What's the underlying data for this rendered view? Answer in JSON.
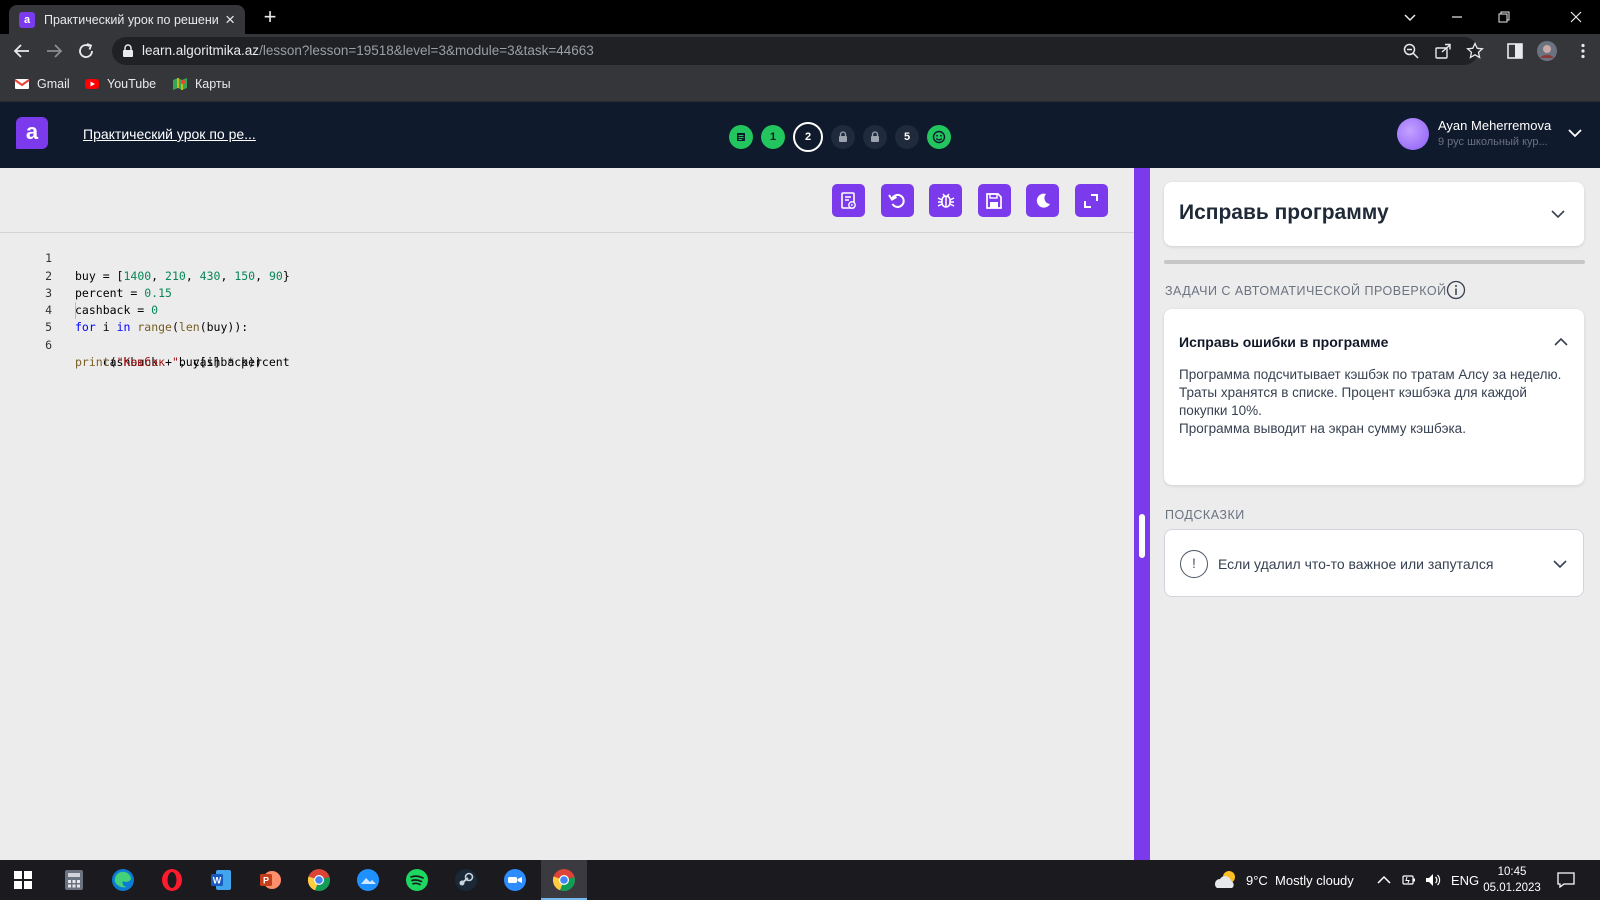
{
  "browser": {
    "tab_title": "Практический урок по решению",
    "tab_favicon": "a",
    "url_host": "learn.algoritmika.az",
    "url_path": "/lesson?lesson=19518&level=3&module=3&task=44663",
    "bookmarks": [
      {
        "label": "Gmail",
        "icon": "gmail-icon"
      },
      {
        "label": "YouTube",
        "icon": "youtube-icon"
      },
      {
        "label": "Карты",
        "icon": "maps-icon"
      }
    ]
  },
  "header": {
    "logo_letter": "a",
    "lesson_title": "Практический урок по ре...",
    "steps": [
      {
        "label": "",
        "kind": "doc-icon",
        "state": "done"
      },
      {
        "label": "1",
        "kind": "number",
        "state": "done"
      },
      {
        "label": "2",
        "kind": "number",
        "state": "current"
      },
      {
        "label": "",
        "kind": "lock-icon",
        "state": "locked"
      },
      {
        "label": "",
        "kind": "lock-icon",
        "state": "locked"
      },
      {
        "label": "5",
        "kind": "number",
        "state": "open"
      },
      {
        "label": "",
        "kind": "smile-icon",
        "state": "done"
      }
    ],
    "user_name": "Ayan Meherremova",
    "user_course": "9 рус школьный кур..."
  },
  "editor": {
    "tools": [
      "run-checks-icon",
      "reset-icon",
      "debug-icon",
      "save-icon",
      "theme-icon",
      "fullscreen-icon"
    ],
    "lines": [
      {
        "num": "1"
      },
      {
        "num": "2"
      },
      {
        "num": "3"
      },
      {
        "num": "4"
      },
      {
        "num": "5"
      },
      {
        "num": "6"
      }
    ],
    "code": {
      "l1_a": "buy = [",
      "l1_n1": "1400",
      "l1_c1": ", ",
      "l1_n2": "210",
      "l1_c2": ", ",
      "l1_n3": "430",
      "l1_c3": ", ",
      "l1_n4": "150",
      "l1_c4": ", ",
      "l1_n5": "90",
      "l1_b": "}",
      "l2_a": "percent = ",
      "l2_n": "0.15",
      "l3_a": "cashback = ",
      "l3_n": "0",
      "l4_k1": "for",
      "l4_a": " i ",
      "l4_k2": "in",
      "l4_sp": " ",
      "l4_f1": "range",
      "l4_b": "(",
      "l4_f2": "len",
      "l4_c": "(buy)):",
      "l5": "    cashback + buy[i] * percent",
      "l6_f": "print",
      "l6_a": "(",
      "l6_s": "\"Кешбэк \"",
      "l6_b": ", cashback))"
    }
  },
  "panel": {
    "task_title": "Исправь программу",
    "auto_check_label": "ЗАДАЧИ С АВТОМАТИЧЕСКОЙ ПРОВЕРКОЙ",
    "error_card_title": "Исправь ошибки в программе",
    "error_card_body": [
      "Программа подсчитывает кэшбэк по тратам Алсу за неделю.",
      "Траты хранятся в списке. Процент кэшбэка для каждой покупки 10%.",
      "Программа выводит на экран сумму кэшбэка."
    ],
    "hints_label": "ПОДСКАЗКИ",
    "hint_icon_text": "!",
    "hint_text": "Если удалил что-то важное или запутался"
  },
  "taskbar": {
    "weather": "9°C  Mostly cloudy",
    "lang": "ENG",
    "time": "10:45",
    "date": "05.01.2023",
    "apps": [
      "windows-start-icon",
      "calculator-icon",
      "edge-icon",
      "opera-icon",
      "word-icon",
      "powerpoint-icon",
      "chrome-icon",
      "photos-icon",
      "spotify-icon",
      "steam-icon",
      "zoom-icon",
      "chrome-active-icon"
    ]
  },
  "colors": {
    "accent": "#7c3aed",
    "header_bg": "#0f1a2c",
    "step_green": "#22c55e"
  }
}
